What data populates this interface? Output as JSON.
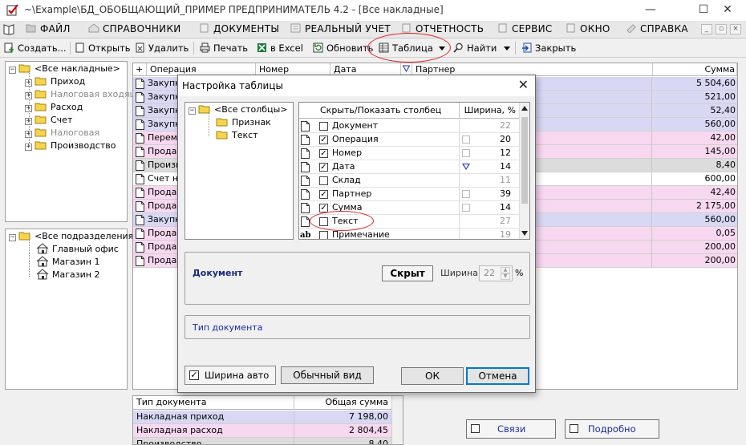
{
  "window": {
    "title": "~\\Example\\БД_ОБОБЩАЮЩИЙ_ПРИМЕР  ПРЕДПРИНИМАТЕЛЬ 4.2 - [Все накладные]",
    "minimize": "—",
    "maximize": "☐",
    "close": "✕"
  },
  "menu": [
    {
      "label": "ФАЙЛ"
    },
    {
      "label": "СПРАВОЧНИКИ"
    },
    {
      "label": "ДОКУМЕНТЫ"
    },
    {
      "label": "РЕАЛЬНЫЙ УЧЕТ"
    },
    {
      "label": "ОТЧЕТНОСТЬ"
    },
    {
      "label": "СЕРВИС"
    },
    {
      "label": "ОКНО"
    },
    {
      "label": "СПРАВКА"
    }
  ],
  "mdi": {
    "minimize": "_",
    "restore": "▫",
    "close": "×"
  },
  "toolbar": {
    "create": "Создать...",
    "open": "Открыть",
    "delete": "Удалить",
    "print": "Печать",
    "excel": "в Excel",
    "refresh": "Обновить",
    "table": "Таблица",
    "find": "Найти",
    "close": "Закрыть"
  },
  "tree_docs": {
    "root": "<Все накладные>",
    "items": [
      {
        "label": "Приход",
        "grey": false
      },
      {
        "label": "Налоговая входящ",
        "grey": true
      },
      {
        "label": "Расход",
        "grey": false
      },
      {
        "label": "Счет",
        "grey": false
      },
      {
        "label": "Налоговая",
        "grey": true
      },
      {
        "label": "Производство",
        "grey": false
      }
    ]
  },
  "tree_depts": {
    "root": "<Все подразделения>",
    "items": [
      "Главный офис",
      "Магазин 1",
      "Магазин 2"
    ]
  },
  "grid": {
    "headers": {
      "plus": "+",
      "operation": "Операция",
      "number": "Номер",
      "date": "Дата",
      "partner": "Партнер",
      "sum": "Сумма"
    },
    "rows": [
      {
        "op": "Закупка",
        "sum": "5 504,60",
        "bg": "blue"
      },
      {
        "op": "Закупка",
        "sum": "521,00",
        "bg": "blue"
      },
      {
        "op": "Закупка",
        "sum": "52,40",
        "bg": "blue"
      },
      {
        "op": "Закупка",
        "sum": "560,00",
        "bg": "blue"
      },
      {
        "op": "Перемещение",
        "sum": "42,00",
        "bg": "pink"
      },
      {
        "op": "Продажа",
        "sum": "145,00",
        "bg": "pink"
      },
      {
        "op": "Производство",
        "sum": "8,40",
        "bg": "grey"
      },
      {
        "op": "Счет на оплату",
        "sum": "600,00",
        "bg": "white"
      },
      {
        "op": "Продажа",
        "sum": "42,40",
        "bg": "pink"
      },
      {
        "op": "Продажа",
        "sum": "2 175,00",
        "bg": "pink"
      },
      {
        "op": "Закупка",
        "sum": "560,00",
        "bg": "blue"
      },
      {
        "op": "Продажа",
        "sum": "0,05",
        "bg": "pink"
      },
      {
        "op": "Продажа",
        "sum": "200,00",
        "bg": "pink"
      },
      {
        "op": "Продажа",
        "sum": "200,00",
        "bg": "pink"
      }
    ]
  },
  "summary": {
    "headers": {
      "type": "Тип документа",
      "total": "Общая сумма"
    },
    "rows": [
      {
        "type": "Накладная приход",
        "total": "7 198,00",
        "bg": "blue"
      },
      {
        "type": "Накладная расход",
        "total": "2 804,45",
        "bg": "pink"
      },
      {
        "type": "Производство",
        "total": "8,40",
        "bg": "grey"
      }
    ]
  },
  "bottom_buttons": {
    "links": "Связи",
    "details": "Подробно"
  },
  "dialog": {
    "title": "Настройка таблицы",
    "close": "✕",
    "tree": {
      "root": "<Все столбцы>",
      "items": [
        "Признак",
        "Текст"
      ]
    },
    "columns_header": {
      "name": "Скрыть/Показать столбец",
      "width": "Ширина, %"
    },
    "columns": [
      {
        "name": "Документ",
        "checked": false,
        "width": "22",
        "icon": "page",
        "marker": "none",
        "grey_width": true
      },
      {
        "name": "Операция",
        "checked": true,
        "width": "20",
        "icon": "page",
        "marker": "box",
        "grey_width": false
      },
      {
        "name": "Номер",
        "checked": true,
        "width": "12",
        "icon": "page",
        "marker": "box",
        "grey_width": false
      },
      {
        "name": "Дата",
        "checked": true,
        "width": "14",
        "icon": "page",
        "marker": "sort",
        "grey_width": false
      },
      {
        "name": "Склад",
        "checked": false,
        "width": "11",
        "icon": "page",
        "marker": "none",
        "grey_width": true
      },
      {
        "name": "Партнер",
        "checked": true,
        "width": "39",
        "icon": "page",
        "marker": "box",
        "grey_width": false
      },
      {
        "name": "Сумма",
        "checked": true,
        "width": "14",
        "icon": "page",
        "marker": "box",
        "grey_width": false
      },
      {
        "name": "Текст",
        "checked": false,
        "width": "27",
        "icon": "page",
        "marker": "none",
        "grey_width": true
      },
      {
        "name": "Примечание",
        "checked": false,
        "width": "19",
        "icon": "ab",
        "marker": "none",
        "grey_width": true
      }
    ],
    "detail": {
      "name": "Документ",
      "state_button": "Скрыт",
      "width_label": "Ширина=",
      "width_value": "22",
      "percent": "%"
    },
    "description": "Тип документа",
    "auto_width": {
      "label": "Ширина авто",
      "checked": true
    },
    "normal_view": "Обычный вид",
    "ok": "ОК",
    "cancel": "Отмена"
  },
  "colors": {
    "blue_row": "#d8d8f4",
    "pink_row": "#f8d8f0",
    "grey_row": "#dcdcdc",
    "link_text": "#1a2aa0",
    "annotation": "#dd2222"
  }
}
